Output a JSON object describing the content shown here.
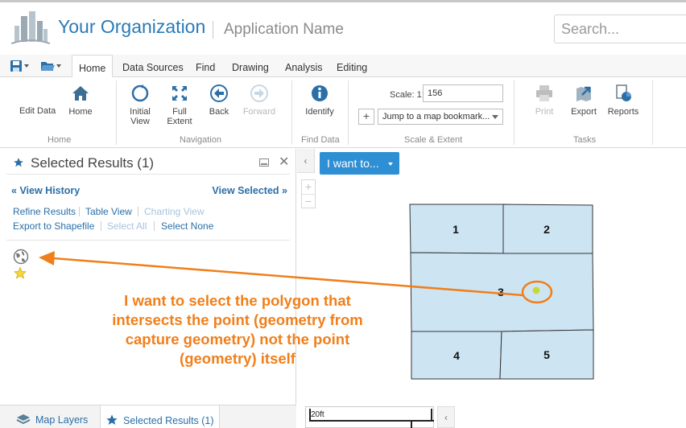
{
  "header": {
    "org_name": "Your Organization",
    "app_name": "Application Name",
    "search_placeholder": "Search..."
  },
  "tabs": [
    "Home",
    "Data Sources",
    "Find",
    "Drawing",
    "Analysis",
    "Editing"
  ],
  "active_tab": "Home",
  "ribbon": {
    "home_group": {
      "edit_data": "Edit Data",
      "home": "Home",
      "label": "Home"
    },
    "navigation": {
      "initial_view": "Initial View",
      "full_extent": "Full Extent",
      "back": "Back",
      "forward": "Forward",
      "label": "Navigation"
    },
    "find_data": {
      "identify": "Identify",
      "label": "Find Data"
    },
    "scale_extent": {
      "scale_label": "Scale: 1:",
      "scale_value": "156",
      "bookmark_placeholder": "Jump to a map bookmark...",
      "label": "Scale & Extent"
    },
    "tasks": {
      "print": "Print",
      "export": "Export",
      "reports": "Reports",
      "label": "Tasks"
    }
  },
  "panel": {
    "title": "Selected Results (1)",
    "view_history": "View History",
    "view_selected": "View Selected",
    "links": {
      "refine": "Refine Results",
      "table_view": "Table View",
      "charting_view": "Charting View",
      "export_shapefile": "Export to Shapefile",
      "select_all": "Select All",
      "select_none": "Select None"
    },
    "bottom_tabs": {
      "map_layers": "Map Layers",
      "selected_results": "Selected Results (1)"
    }
  },
  "map": {
    "i_want_to": "I want to...",
    "scalebar_label": "20ft",
    "polygons": [
      "1",
      "2",
      "3",
      "4",
      "5"
    ],
    "polygon_fill": "#cde5f3",
    "point_color": "#c8d83a"
  },
  "annotation": {
    "text": "I want to select the polygon that intersects the point (geometry from capture geometry) not the point (geometry) itself",
    "color": "#f07f1b"
  }
}
